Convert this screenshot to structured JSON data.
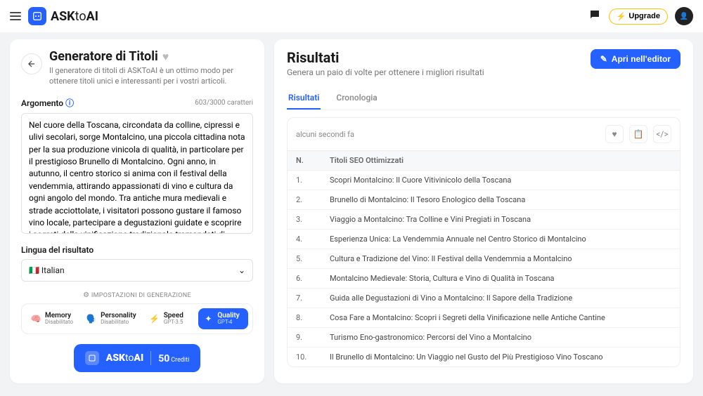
{
  "topbar": {
    "brand_prefix": "ASK",
    "brand_mid": "to",
    "brand_suffix": "AI",
    "upgrade_label": "Upgrade"
  },
  "left": {
    "title": "Generatore di Titoli",
    "subtitle": "Il generatore di titoli di ASKToAI è un ottimo modo per ottenere titoli unici e interessanti per i vostri articoli.",
    "argomento_label": "Argomento",
    "char_count": "603/3000 caratteri",
    "textarea_value": "Nel cuore della Toscana, circondata da colline, cipressi e ulivi secolari, sorge Montalcino, una piccola cittadina nota per la sua produzione vinicola di qualità, in particolare per il prestigioso Brunello di Montalcino. Ogni anno, in autunno, il centro storico si anima con il festival della vendemmia, attirando appassionati di vino e cultura da ogni angolo del mondo. Tra antiche mura medievali e strade acciottolate, i visitatori possono gustare il famoso vino locale, partecipare a degustazioni guidate e scoprire i segreti della vinificazione tradizionale tramandati di generazione in generazione.",
    "lang_label": "Lingua del risultato",
    "lang_value": "🇮🇹 Italian",
    "gen_settings_label": "IMPOSTAZIONI DI GENERAZIONE",
    "chips": [
      {
        "title": "Memory",
        "sub": "Disabilitato",
        "icon": "🧠"
      },
      {
        "title": "Personality",
        "sub": "Disabilitato",
        "icon": "🗣️"
      },
      {
        "title": "Speed",
        "sub": "GPT-3.5",
        "icon": "⚡"
      },
      {
        "title": "Quality",
        "sub": "GPT-4",
        "icon": "✦"
      }
    ],
    "ask_btn_brand": "ASKtoAI",
    "ask_btn_credits_num": "50",
    "ask_btn_credits_label": "Crediti"
  },
  "right": {
    "title": "Risultati",
    "subtitle": "Genera un paio di volte per ottenere i migliori risultati",
    "editor_btn": "Apri nell'editor",
    "tabs": {
      "results": "Risultati",
      "history": "Cronologia"
    },
    "timestamp": "alcuni secondi fa",
    "col_num": "N.",
    "col_title": "Titoli SEO Ottimizzati",
    "rows": [
      {
        "n": "1.",
        "t": "Scopri Montalcino: Il Cuore Vitivinicolo della Toscana"
      },
      {
        "n": "2.",
        "t": "Brunello di Montalcino: Il Tesoro Enologico della Toscana"
      },
      {
        "n": "3.",
        "t": "Viaggio a Montalcino: Tra Colline e Vini Pregiati in Toscana"
      },
      {
        "n": "4.",
        "t": "Esperienza Unica: La Vendemmia Annuale nel Centro Storico di Montalcino"
      },
      {
        "n": "5.",
        "t": "Cultura e Tradizione del Vino: Il Festival della Vendemmia a Montalcino"
      },
      {
        "n": "6.",
        "t": "Montalcino Medievale: Storia, Cultura e Vino di Qualità in Toscana"
      },
      {
        "n": "7.",
        "t": "Guida alle Degustazioni di Vino a Montalcino: Il Sapore della Tradizione"
      },
      {
        "n": "8.",
        "t": "Cosa Fare a Montalcino: Scopri i Segreti della Vinificazione nelle Antiche Cantine"
      },
      {
        "n": "9.",
        "t": "Turismo Eno-gastronomico: Percorsi del Vino a Montalcino"
      },
      {
        "n": "10.",
        "t": "Il Brunello di Montalcino: Un Viaggio nel Gusto del Più Prestigioso Vino Toscano"
      }
    ]
  }
}
